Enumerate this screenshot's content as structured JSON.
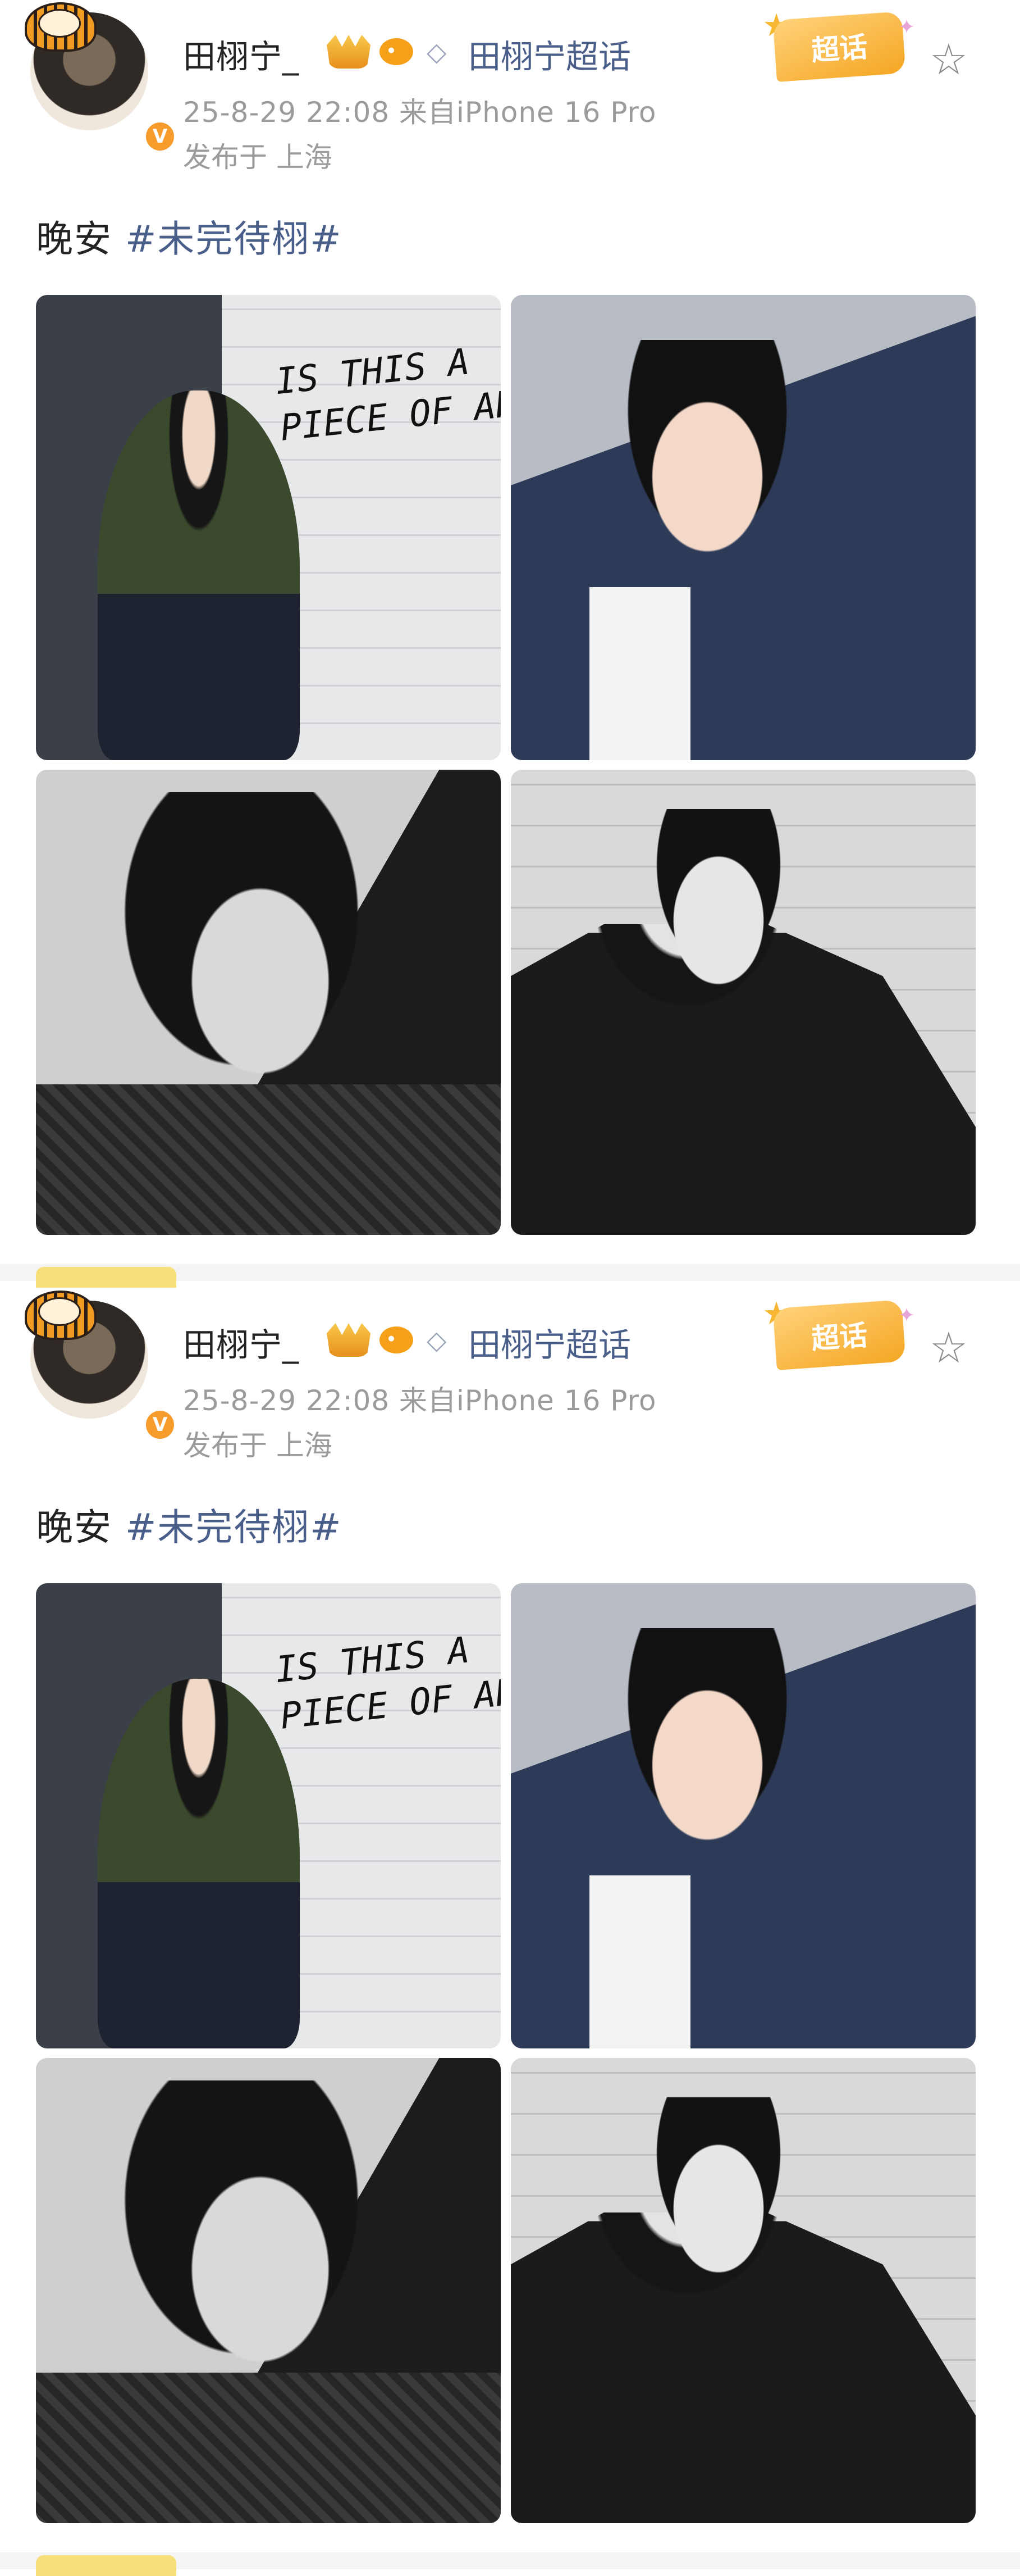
{
  "posts": [
    {
      "username": "田栩宁_",
      "super_topic": "田栩宁超话",
      "time_source": "25-8-29 22:08  来自iPhone 16 Pro",
      "location": "发布于 上海",
      "badge_label": "超话",
      "caption_text": "晚安 ",
      "caption_tag": "#未完待栩#",
      "graffiti": "IS THIS A\nPIECE OF ART",
      "verified": "V"
    },
    {
      "username": "田栩宁_",
      "super_topic": "田栩宁超话",
      "time_source": "25-8-29 22:08  来自iPhone 16 Pro",
      "location": "发布于 上海",
      "badge_label": "超话",
      "caption_text": "晚安 ",
      "caption_tag": "#未完待栩#",
      "graffiti": "IS THIS A\nPIECE OF ART",
      "verified": "V"
    }
  ],
  "icons": {
    "favorite": "star-outline-icon",
    "diamond": "diamond-icon",
    "crown": "crown-icon",
    "fish": "fish-icon"
  },
  "colors": {
    "link": "#4a5e8a",
    "meta": "#9b9b9b",
    "badge": "#f5a623"
  }
}
